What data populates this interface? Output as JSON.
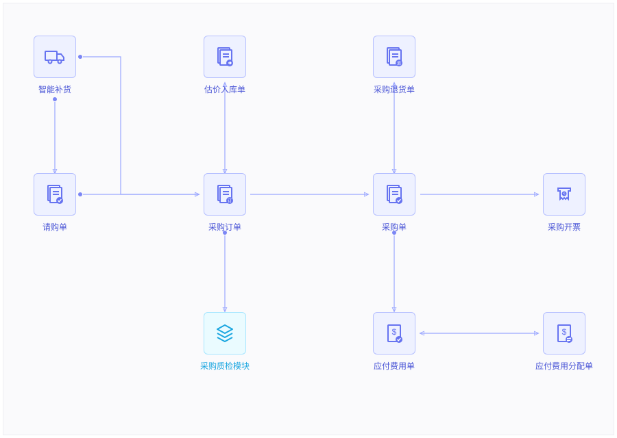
{
  "nodes": {
    "smart_restock": {
      "label": "智能补货",
      "icon": "truck"
    },
    "purchase_request": {
      "label": "请购单",
      "icon": "doc-check"
    },
    "estimate_inbound": {
      "label": "估价入库单",
      "icon": "doc-arrow"
    },
    "purchase_order": {
      "label": "采购订单",
      "icon": "doc-tag"
    },
    "purchase_return": {
      "label": "采购退货单",
      "icon": "doc-return"
    },
    "purchase_slip": {
      "label": "采购单",
      "icon": "doc-check"
    },
    "purchase_invoice": {
      "label": "采购开票",
      "icon": "receipt"
    },
    "qc_module": {
      "label": "采购质检模块",
      "icon": "stack",
      "alt": true
    },
    "payable_expense": {
      "label": "应付费用单",
      "icon": "doc-money"
    },
    "payable_alloc": {
      "label": "应付费用分配单",
      "icon": "doc-swap"
    }
  },
  "colors": {
    "primary": "#6673f0",
    "box_border": "#b6c0ff",
    "alt": "#1aa6e0"
  }
}
